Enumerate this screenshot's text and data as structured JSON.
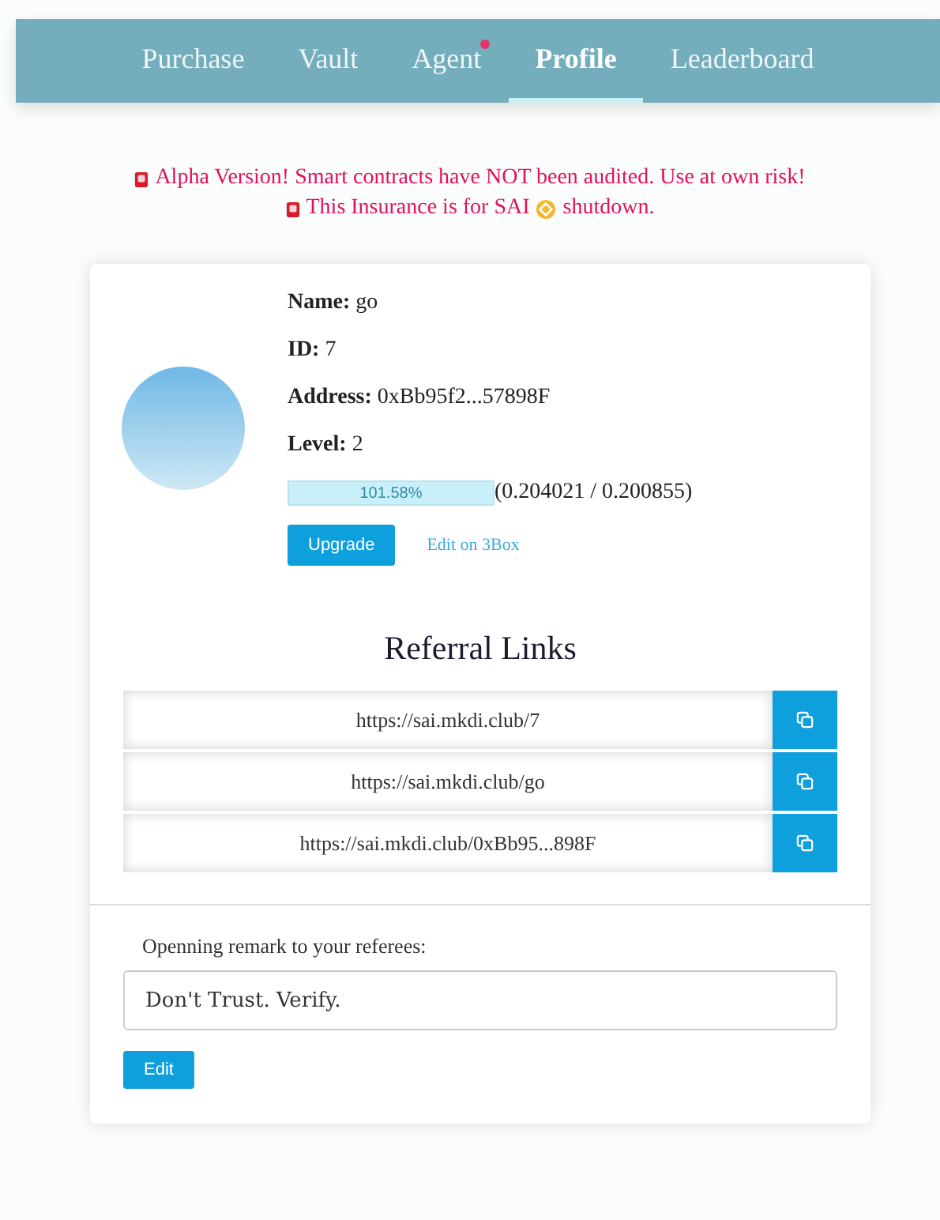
{
  "nav": {
    "tabs": [
      {
        "label": "Purchase",
        "selected": false,
        "notification": false
      },
      {
        "label": "Vault",
        "selected": false,
        "notification": false
      },
      {
        "label": "Agent",
        "selected": false,
        "notification": true
      },
      {
        "label": "Profile",
        "selected": true,
        "notification": false
      },
      {
        "label": "Leaderboard",
        "selected": false,
        "notification": false
      }
    ]
  },
  "alerts": {
    "warning": "Alpha Version! Smart contracts have NOT been audited. Use at own risk!",
    "insurance_before": "This Insurance is for SAI",
    "insurance_after": "shutdown."
  },
  "profile": {
    "fields": [
      {
        "label": "Name:",
        "value": "go"
      },
      {
        "label": "ID:",
        "value": "7"
      },
      {
        "label": "Address:",
        "value": "0xBb95f2...57898F"
      },
      {
        "label": "Level:",
        "value": "2"
      }
    ],
    "progress": {
      "level": 1,
      "percent": "101.58%",
      "reading": "(0.204021 / 0.200855)"
    },
    "upgrade_button": "Upgrade",
    "edit_link": "Edit on 3Box"
  },
  "referral": {
    "title": "Referral Links",
    "links": [
      "https://sai.mkdi.club/7",
      "https://sai.mkdi.club/go",
      "https://sai.mkdi.club/0xBb95...898F"
    ]
  },
  "remark": {
    "label": "Openning remark to your referees:",
    "value": "Don't Trust. Verify.",
    "edit_button": "Edit"
  }
}
